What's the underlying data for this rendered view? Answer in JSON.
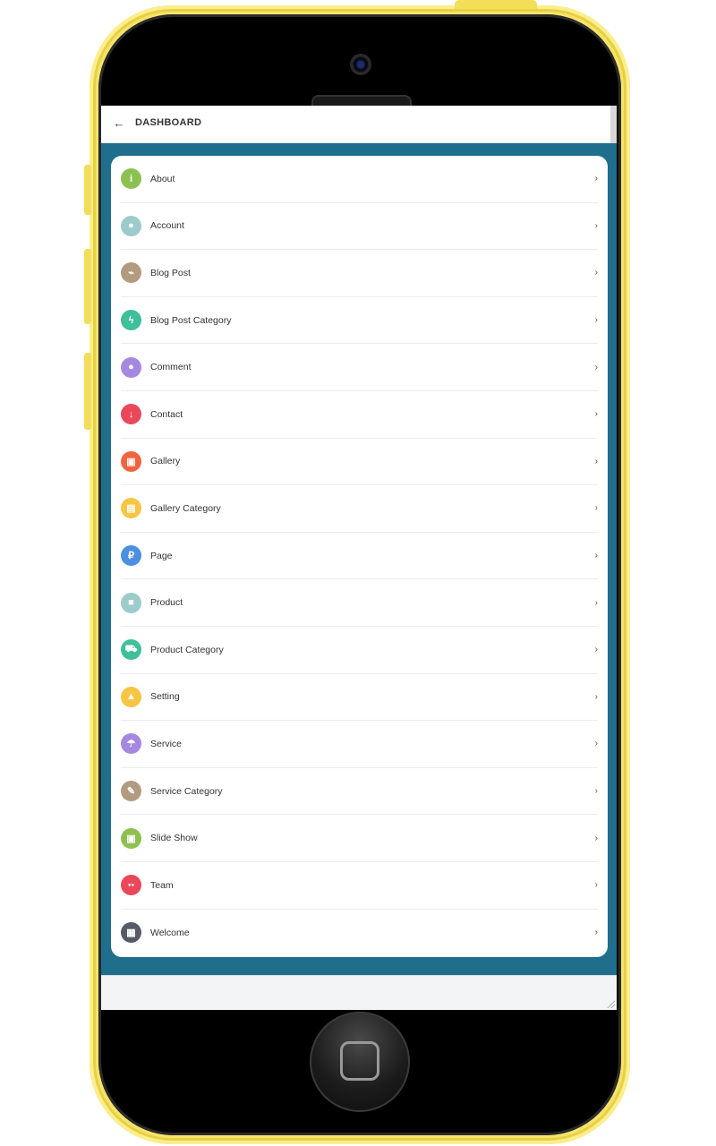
{
  "header": {
    "back_icon": "arrow-left-icon",
    "title": "DASHBOARD"
  },
  "menu": [
    {
      "label": "About",
      "icon": "info-icon",
      "glyph": "i",
      "color": "#8cc152"
    },
    {
      "label": "Account",
      "icon": "user-icon",
      "glyph": "●",
      "color": "#9dcbcb"
    },
    {
      "label": "Blog Post",
      "icon": "rss-icon",
      "glyph": "⌁",
      "color": "#b39b80"
    },
    {
      "label": "Blog Post Category",
      "icon": "bolt-icon",
      "glyph": "ϟ",
      "color": "#3fbf9a"
    },
    {
      "label": "Comment",
      "icon": "comment-icon",
      "glyph": "●",
      "color": "#a688e0"
    },
    {
      "label": "Contact",
      "icon": "map-pin-icon",
      "glyph": "↓",
      "color": "#e8485a"
    },
    {
      "label": "Gallery",
      "icon": "image-icon",
      "glyph": "▣",
      "color": "#f4633f"
    },
    {
      "label": "Gallery Category",
      "icon": "images-icon",
      "glyph": "▤",
      "color": "#f6c543"
    },
    {
      "label": "Page",
      "icon": "ruble-icon",
      "glyph": "₽",
      "color": "#4a8fe0"
    },
    {
      "label": "Product",
      "icon": "shopping-bag-icon",
      "glyph": "■",
      "color": "#9dcbcb"
    },
    {
      "label": "Product Category",
      "icon": "shopping-cart-icon",
      "glyph": "⛟",
      "color": "#3fbf9a"
    },
    {
      "label": "Setting",
      "icon": "warning-icon",
      "glyph": "▲",
      "color": "#f6c543"
    },
    {
      "label": "Service",
      "icon": "parachute-icon",
      "glyph": "☂",
      "color": "#a688e0"
    },
    {
      "label": "Service Category",
      "icon": "brush-icon",
      "glyph": "✎",
      "color": "#b39b80"
    },
    {
      "label": "Slide Show",
      "icon": "picture-icon",
      "glyph": "▣",
      "color": "#8cc152"
    },
    {
      "label": "Team",
      "icon": "users-icon",
      "glyph": "●●",
      "color": "#e8485a"
    },
    {
      "label": "Welcome",
      "icon": "keyboard-icon",
      "glyph": "▦",
      "color": "#545b67"
    }
  ],
  "chevron": "›"
}
